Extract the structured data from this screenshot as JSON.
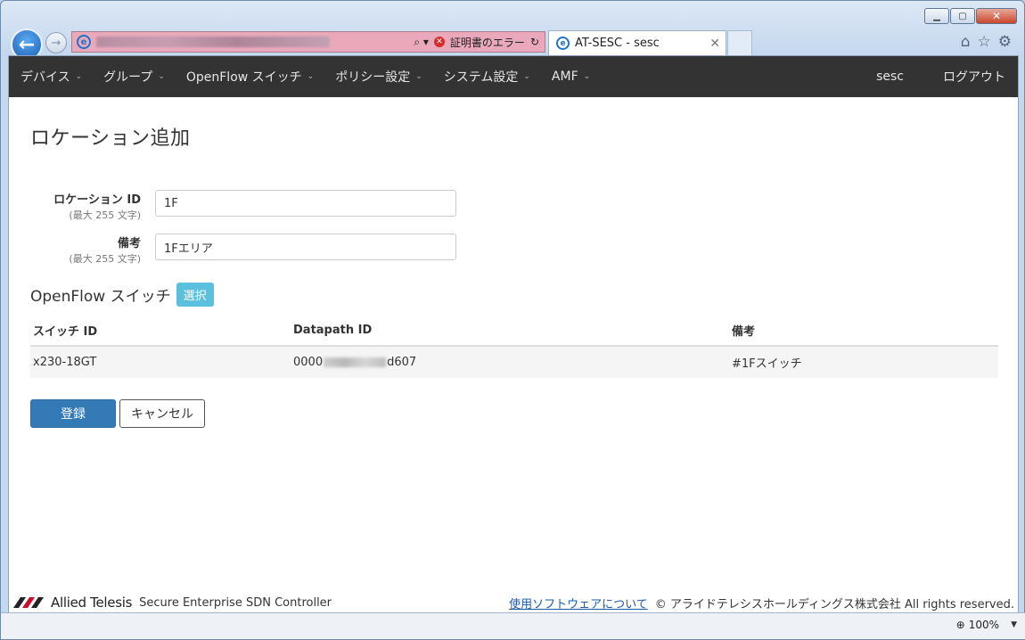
{
  "browser": {
    "security_text": "証明書のエラー",
    "tab_title": "AT-SESC - sesc",
    "zoom": "100%"
  },
  "nav": {
    "items": [
      {
        "label": "デバイス"
      },
      {
        "label": "グループ"
      },
      {
        "label": "OpenFlow スイッチ"
      },
      {
        "label": "ポリシー設定"
      },
      {
        "label": "システム設定"
      },
      {
        "label": "AMF"
      }
    ],
    "user": "sesc",
    "logout": "ログアウト"
  },
  "page": {
    "title": "ロケーション追加"
  },
  "form": {
    "location_id": {
      "label": "ロケーション ID",
      "hint": "(最大 255 文字)",
      "value": "1F"
    },
    "note": {
      "label": "備考",
      "hint": "(最大 255 文字)",
      "value": "1Fエリア"
    }
  },
  "switch_section": {
    "title": "OpenFlow スイッチ",
    "select_label": "選択",
    "columns": [
      "スイッチ ID",
      "Datapath ID",
      "備考"
    ],
    "rows": [
      {
        "switch_id": "x230-18GT",
        "dp_prefix": "0000",
        "dp_suffix": "d607",
        "note": "#1Fスイッチ"
      }
    ]
  },
  "buttons": {
    "submit": "登録",
    "cancel": "キャンセル"
  },
  "footer": {
    "brand": "Allied Telesis",
    "product": "Secure Enterprise SDN Controller",
    "software_link": "使用ソフトウェアについて",
    "copyright": "© アライドテレシスホールディングス株式会社 All rights reserved."
  },
  "colors": {
    "nav_bg": "#333333",
    "primary": "#337ab7",
    "badge": "#5bc0de",
    "addr_error": "#e9a9ba"
  }
}
